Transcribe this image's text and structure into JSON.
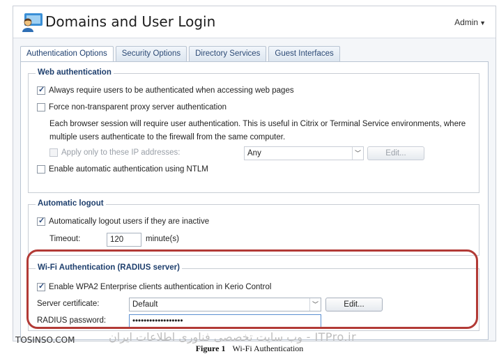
{
  "header": {
    "title": "Domains and User Login",
    "user_menu": "Admin"
  },
  "tabs": [
    {
      "label": "Authentication Options",
      "active": true
    },
    {
      "label": "Security Options",
      "active": false
    },
    {
      "label": "Directory Services",
      "active": false
    },
    {
      "label": "Guest Interfaces",
      "active": false
    }
  ],
  "web_auth": {
    "title": "Web authentication",
    "always_require": {
      "label": "Always require users to be authenticated when accessing web pages",
      "checked": true
    },
    "force_proxy": {
      "label": "Force non-transparent proxy server authentication",
      "checked": false
    },
    "description_line1": "Each browser session will require user authentication. This is useful in Citrix or Terminal Service environments, where",
    "description_line2": "multiple users authenticate to the firewall from the same computer.",
    "apply_only": {
      "label": "Apply only to these IP addresses:",
      "checked": false,
      "disabled": true
    },
    "ip_select_value": "Any",
    "edit_label": "Edit...",
    "ntlm": {
      "label": "Enable automatic authentication using NTLM",
      "checked": false
    }
  },
  "auto_logout": {
    "title": "Automatic logout",
    "logout_inactive": {
      "label": "Automatically logout users if they are inactive",
      "checked": true
    },
    "timeout_label": "Timeout:",
    "timeout_value": "120",
    "timeout_unit": "minute(s)"
  },
  "wifi_auth": {
    "title": "Wi-Fi Authentication (RADIUS server)",
    "enable_wpa2": {
      "label": "Enable WPA2 Enterprise clients authentication in Kerio Control",
      "checked": true
    },
    "cert_label": "Server certificate:",
    "cert_value": "Default",
    "edit_label": "Edit...",
    "radius_label": "RADIUS password:",
    "radius_value": "••••••••••••••••••"
  },
  "watermark": {
    "left": "TOSINSO.COM",
    "right": "ITPro.ir - وب سایت تخصصی فناوری اطلاعات ایران"
  },
  "caption": {
    "number": "Figure 1",
    "text": "Wi-Fi Authentication"
  },
  "colors": {
    "accent_title": "#1e3f6d",
    "highlight": "#b23a36"
  }
}
